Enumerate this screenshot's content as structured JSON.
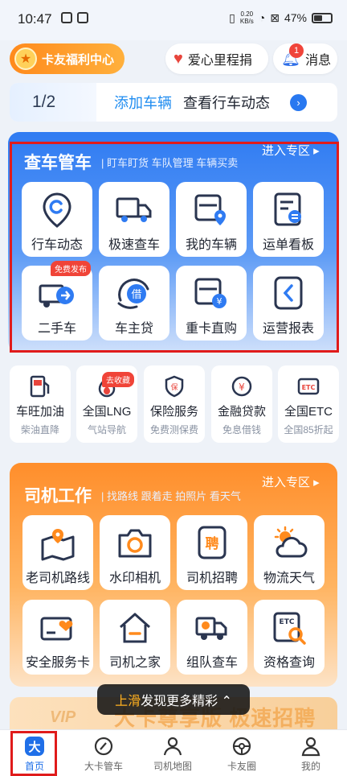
{
  "status_bar": {
    "time": "10:47",
    "net_speed": "0.20\nKB/s",
    "battery": "47%"
  },
  "header": {
    "welfare_label": "卡友福利中心",
    "love_label": "爱心里程捐",
    "message_label": "消息",
    "message_badge": "1"
  },
  "task_banner": {
    "progress": "1/2",
    "action": "添加车辆",
    "hint": "查看行车动态"
  },
  "vehicle_section": {
    "title": "查车管车",
    "subtitle": "| 盯车盯货 车队管理 车辆买卖",
    "enter_label": "进入专区 ▸",
    "tiles": [
      {
        "label": "行车动态",
        "icon": "location-c-icon"
      },
      {
        "label": "极速查车",
        "icon": "truck-icon"
      },
      {
        "label": "我的车辆",
        "icon": "truck-pin-icon"
      },
      {
        "label": "运单看板",
        "icon": "waybill-icon"
      },
      {
        "label": "二手车",
        "icon": "used-truck-icon",
        "tag": "免费发布"
      },
      {
        "label": "车主贷",
        "icon": "loan-icon"
      },
      {
        "label": "重卡直购",
        "icon": "heavy-truck-yen-icon"
      },
      {
        "label": "运营报表",
        "icon": "report-icon"
      }
    ]
  },
  "services": [
    {
      "title": "车旺加油",
      "sub": "柴油直降",
      "icon": "fuel-icon"
    },
    {
      "title": "全国LNG",
      "sub": "气站导航",
      "icon": "lng-icon",
      "tag": "去收藏"
    },
    {
      "title": "保险服务",
      "sub": "免费测保费",
      "icon": "insurance-icon"
    },
    {
      "title": "金融贷款",
      "sub": "免息借钱",
      "icon": "finance-icon"
    },
    {
      "title": "全国ETC",
      "sub": "全国85折起",
      "icon": "etc-icon"
    }
  ],
  "driver_section": {
    "title": "司机工作",
    "subtitle": "| 找路线 跟着走 拍照片 看天气",
    "enter_label": "进入专区 ▸",
    "tiles": [
      {
        "label": "老司机路线",
        "icon": "map-pin-icon"
      },
      {
        "label": "水印相机",
        "icon": "camera-icon"
      },
      {
        "label": "司机招聘",
        "icon": "recruit-icon"
      },
      {
        "label": "物流天气",
        "icon": "weather-icon"
      },
      {
        "label": "安全服务卡",
        "icon": "heart-card-icon"
      },
      {
        "label": "司机之家",
        "icon": "home-icon"
      },
      {
        "label": "组队查车",
        "icon": "team-truck-icon"
      },
      {
        "label": "资格查询",
        "icon": "etc-search-icon"
      }
    ]
  },
  "vip_banner": {
    "text": "大卡尊享版 极速招聘",
    "badge": "VIP"
  },
  "swipe_tip": {
    "highlight": "上滑",
    "text": "发现更多精彩 ⌃"
  },
  "nav": [
    {
      "label": "首页",
      "icon": "home-tab-icon",
      "active": true
    },
    {
      "label": "大卡管车",
      "icon": "manage-tab-icon"
    },
    {
      "label": "司机地图",
      "icon": "driver-map-tab-icon"
    },
    {
      "label": "卡友圈",
      "icon": "wheel-tab-icon"
    },
    {
      "label": "我的",
      "icon": "profile-tab-icon"
    }
  ],
  "colors": {
    "blue_accent": "#2f7bf2",
    "orange_accent": "#ff8e2b",
    "frame_red": "#e01b1b"
  }
}
